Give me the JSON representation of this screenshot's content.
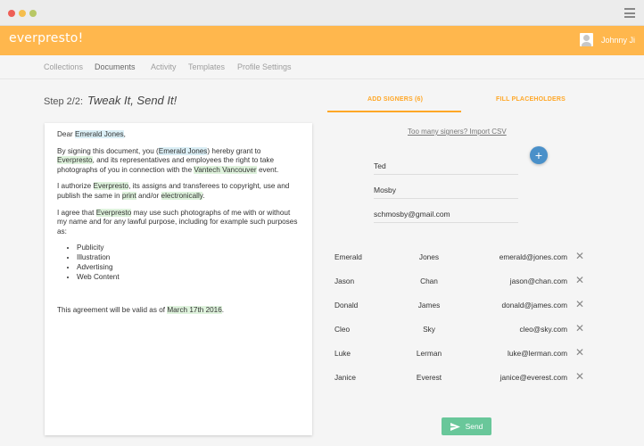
{
  "app": {
    "logo": "everpresto!"
  },
  "user": {
    "name": "Johnny Ji"
  },
  "nav": {
    "items": [
      "Collections",
      "Documents",
      "Activity",
      "Templates",
      "Profile Settings"
    ],
    "active": "Documents"
  },
  "step": {
    "label": "Step 2/2:",
    "title": "Tweak It, Send It!"
  },
  "tabs": {
    "add_signers": "ADD SIGNERS (6)",
    "fill_placeholders": "FILL PLACEHOLDERS"
  },
  "document": {
    "greeting": "Dear",
    "name": "Emerald Jones",
    "comma": ",",
    "p1_a": "By signing this document, you (",
    "p1_name": "Emerald Jones",
    "p1_b": ") hereby grant to",
    "company": "Everpresto",
    "p1_c": ", and its representatives and employees the right to take photographs of you in connection with the",
    "event": "Vantech Vancouver",
    "p1_d": "event.",
    "p2_a": "I authorize",
    "p2_b": ", its assigns and transferees to copyright, use and publish the same in",
    "print": "print",
    "p2_c": "and/or",
    "electronic": "electronically",
    "p2_d": ".",
    "p3_a": "I agree that",
    "p3_b": "may use such photographs of me with or without my name and for any lawful purpose, including for example such purposes as:",
    "purposes": [
      "Publicity",
      "Illustration",
      "Advertising",
      "Web Content"
    ],
    "p4_a": "This agreement will be valid as of",
    "date": "March 17th 2016",
    "p4_b": "."
  },
  "signer_form": {
    "too_many_link": "Too many signers? Import CSV",
    "first_name": "Ted",
    "last_name": "Mosby",
    "email": "schmosby@gmail.com",
    "add_icon": "plus-icon"
  },
  "signers": [
    {
      "first": "Emerald",
      "last": "Jones",
      "email": "emerald@jones.com"
    },
    {
      "first": "Jason",
      "last": "Chan",
      "email": "jason@chan.com"
    },
    {
      "first": "Donald",
      "last": "James",
      "email": "donald@james.com"
    },
    {
      "first": "Cleo",
      "last": "Sky",
      "email": "cleo@sky.com"
    },
    {
      "first": "Luke",
      "last": "Lerman",
      "email": "luke@lerman.com"
    },
    {
      "first": "Janice",
      "last": "Everest",
      "email": "janice@everest.com"
    }
  ],
  "send_button": {
    "label": "Send",
    "icon": "send-icon"
  },
  "colors": {
    "brand": "#ffb74d",
    "accent": "#ffa726",
    "fab": "#4a90c9",
    "send": "#69c79a"
  }
}
